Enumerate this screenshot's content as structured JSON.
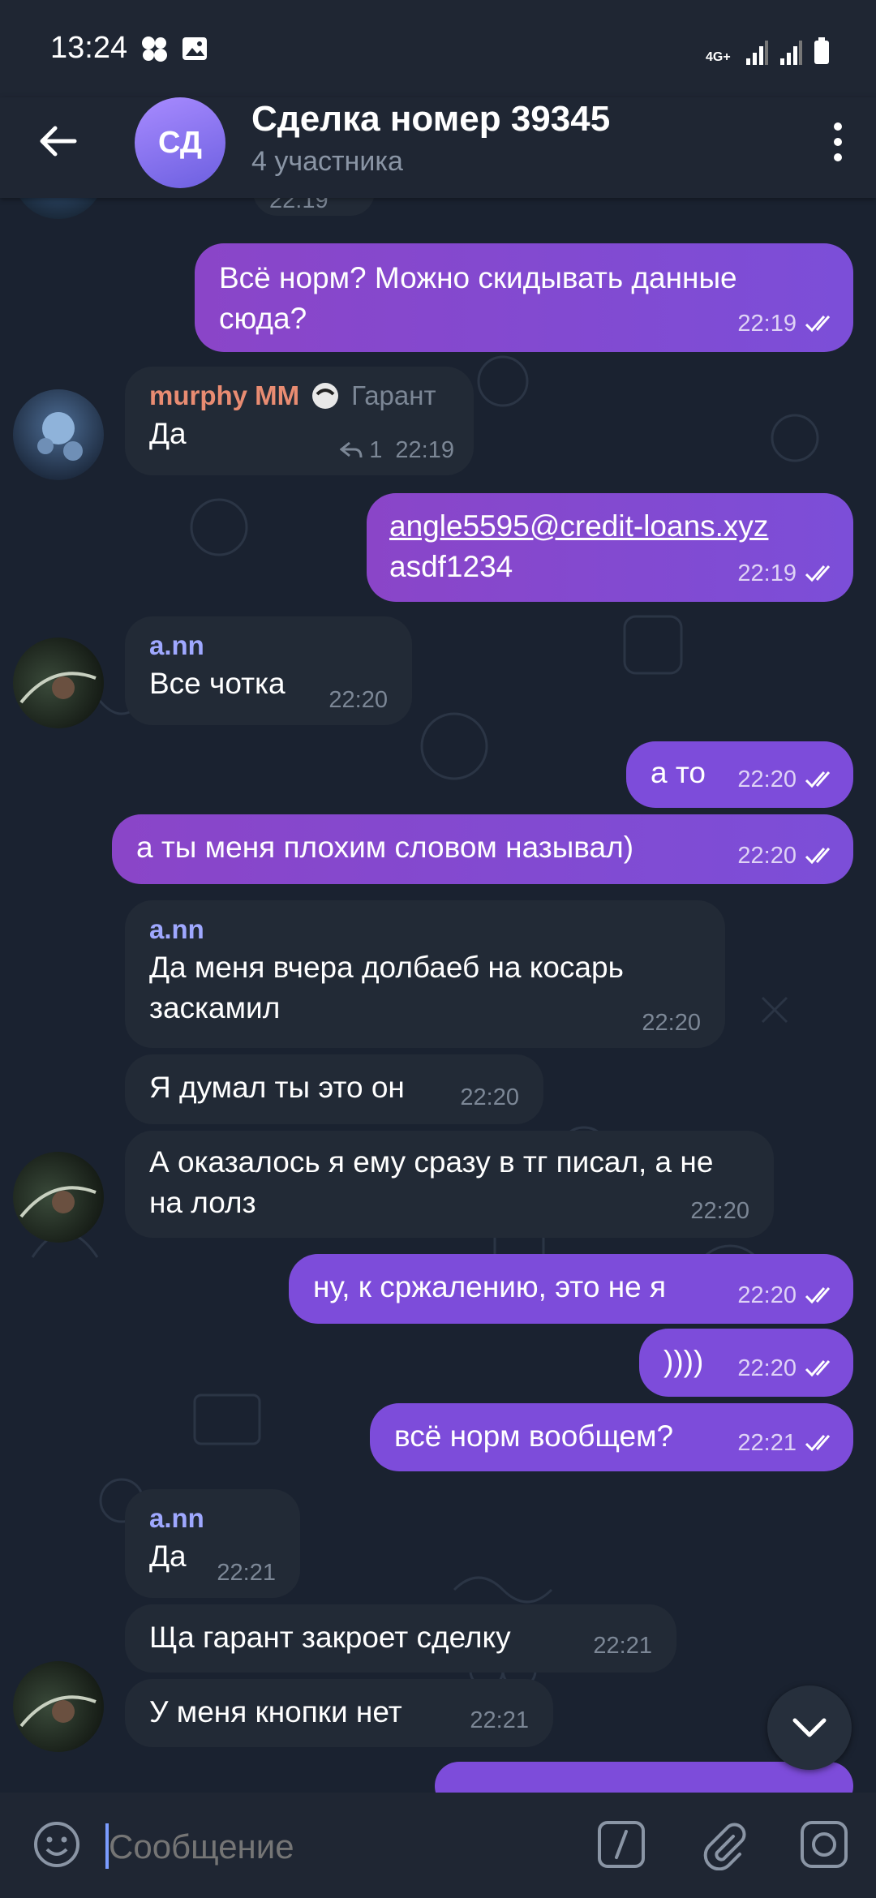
{
  "status_bar": {
    "time": "13:24",
    "network": "4G+"
  },
  "header": {
    "avatar_initials": "СД",
    "title": "Сделка номер 39345",
    "subtitle": "4 участника"
  },
  "messages": [
    {
      "text": "22:19"
    },
    {
      "text": "Всё норм? Можно скидывать данные сюда?",
      "time": "22:19"
    },
    {
      "sender": "murphy MM",
      "badge": "Гарант",
      "text": "Да",
      "reply_count": "1",
      "time": "22:19"
    },
    {
      "text_line1": "angle5595@credit-loans.xyz",
      "text_line2": "asdf1234",
      "time": "22:19"
    },
    {
      "sender": "a.nn",
      "text": "Все чотка",
      "time": "22:20"
    },
    {
      "text": "а то",
      "time": "22:20"
    },
    {
      "text": "а ты меня плохим словом называл)",
      "time": "22:20"
    },
    {
      "sender": "a.nn",
      "text": "Да меня вчера долбаеб на косарь заскамил",
      "time": "22:20"
    },
    {
      "text": "Я думал ты это он",
      "time": "22:20"
    },
    {
      "text": "А оказалось я ему сразу в тг писал, а не на лолз",
      "time": "22:20"
    },
    {
      "text": "ну, к сржалению, это не я",
      "time": "22:20"
    },
    {
      "text": "))))",
      "time": "22:20"
    },
    {
      "text": "всё норм вообщем?",
      "time": "22:21"
    },
    {
      "sender": "a.nn",
      "text": "Да",
      "time": "22:21"
    },
    {
      "text": "Ща гарант закроет сделку",
      "time": "22:21"
    },
    {
      "text": "У меня кнопки нет",
      "time": "22:21"
    }
  ],
  "input": {
    "placeholder": "Сообщение"
  },
  "colors": {
    "outgoing": "#7d4cda",
    "incoming": "#222a36",
    "sender_murphy": "#e98c72",
    "sender_ann": "#9fa8ff",
    "header_bg": "#1f2633"
  }
}
